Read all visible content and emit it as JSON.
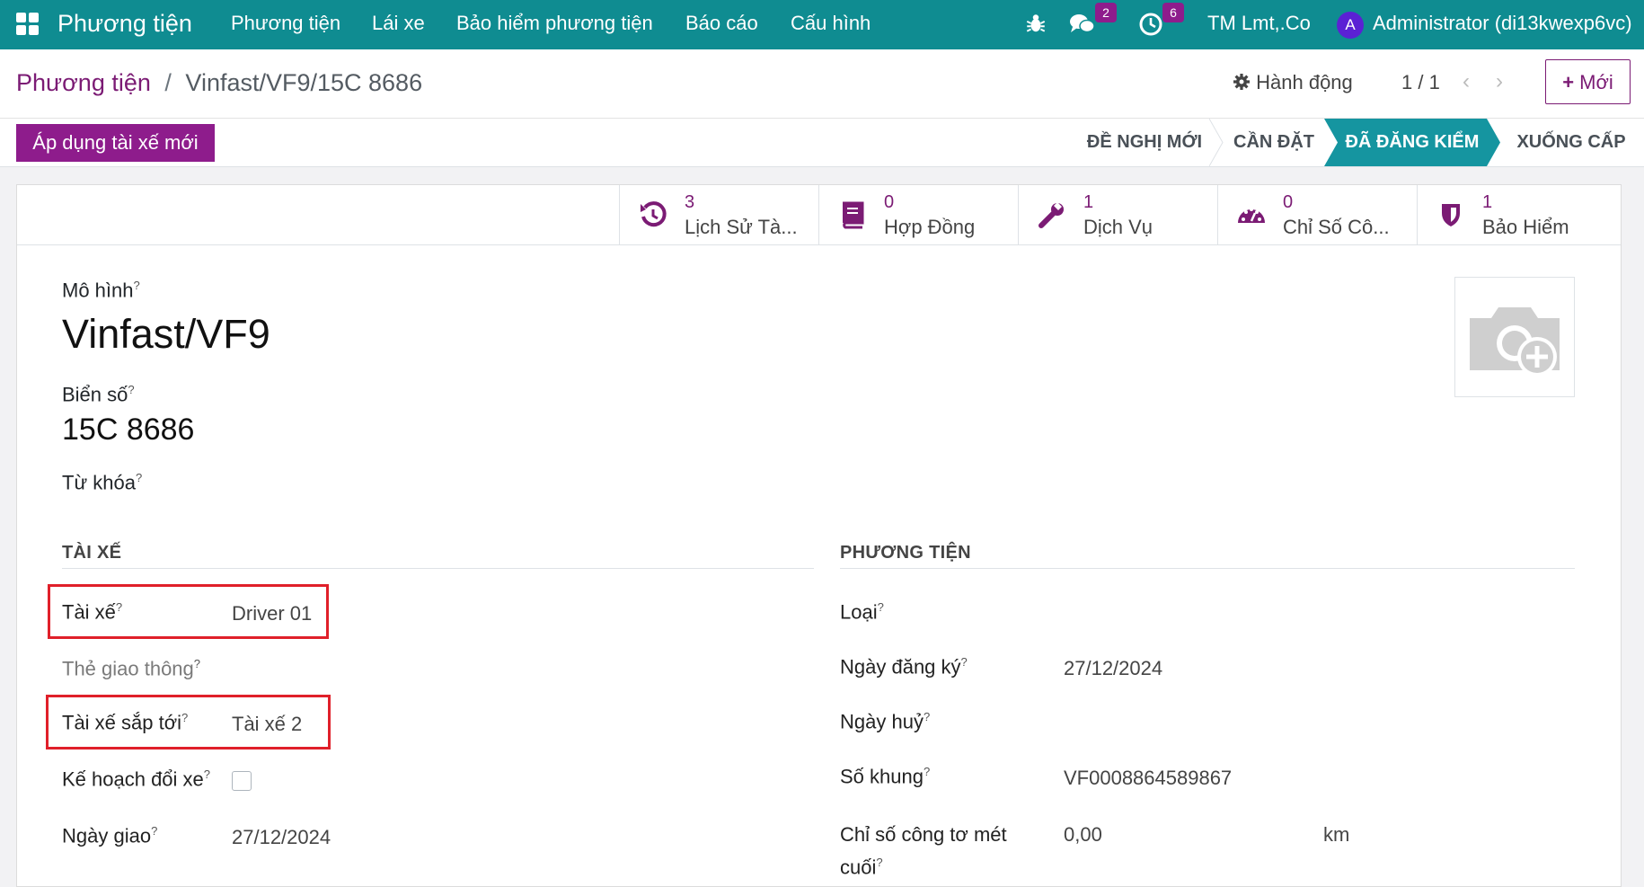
{
  "nav": {
    "app_title": "Phương tiện",
    "menu": [
      "Phương tiện",
      "Lái xe",
      "Bảo hiểm phương tiện",
      "Báo cáo",
      "Cấu hình"
    ],
    "messages_count": "2",
    "activities_count": "6",
    "company": "TM Lmt,.Co",
    "avatar_letter": "A",
    "user": "Administrator (di13kwexp6vc)"
  },
  "breadcrumb": {
    "parent": "Phương tiện",
    "separator": "/",
    "current": "Vinfast/VF9/15C 8686"
  },
  "control": {
    "actions_label": "Hành động",
    "pager": "1 / 1",
    "new_label": "Mới"
  },
  "status": {
    "apply_button": "Áp dụng tài xế mới",
    "stages": [
      "ĐỀ NGHỊ MỚI",
      "CẦN ĐẶT",
      "ĐÃ ĐĂNG KIỂM",
      "XUỐNG CẤP"
    ],
    "active_stage": "ĐÃ ĐĂNG KIỂM"
  },
  "smart_buttons": [
    {
      "count": "3",
      "label": "Lịch Sử Tà...",
      "icon": "history-icon"
    },
    {
      "count": "0",
      "label": "Hợp Đồng",
      "icon": "book-icon"
    },
    {
      "count": "1",
      "label": "Dịch Vụ",
      "icon": "wrench-icon"
    },
    {
      "count": "0",
      "label": "Chỉ Số Cô...",
      "icon": "tachometer-icon"
    },
    {
      "count": "1",
      "label": "Bảo Hiểm",
      "icon": "shield-icon"
    }
  ],
  "form": {
    "model_label": "Mô hình",
    "model_value": "Vinfast/VF9",
    "plate_label": "Biển số",
    "plate_value": "15C 8686",
    "tags_label": "Từ khóa",
    "help_mark": "?",
    "driver_section": {
      "title": "TÀI XẾ",
      "driver_label": "Tài xế",
      "driver_value": "Driver 01",
      "card_label": "Thẻ giao thông",
      "future_driver_label": "Tài xế sắp tới",
      "future_driver_value": "Tài xế 2",
      "plan_change_label": "Kế hoạch đổi xe",
      "assign_date_label": "Ngày giao",
      "assign_date_value": "27/12/2024"
    },
    "vehicle_section": {
      "title": "PHƯƠNG TIỆN",
      "type_label": "Loại",
      "reg_date_label": "Ngày đăng ký",
      "reg_date_value": "27/12/2024",
      "cancel_date_label": "Ngày huỷ",
      "chassis_label": "Số khung",
      "chassis_value": "VF0008864589867",
      "odometer_label_1": "Chỉ số công tơ mét",
      "odometer_label_2": "cuối",
      "odometer_value": "0,00",
      "odometer_unit": "km"
    }
  },
  "colors": {
    "navbar": "#0f8c91",
    "brand": "#8e1c8c",
    "active_stage": "#1595a0",
    "highlight_box": "#e0202a"
  }
}
